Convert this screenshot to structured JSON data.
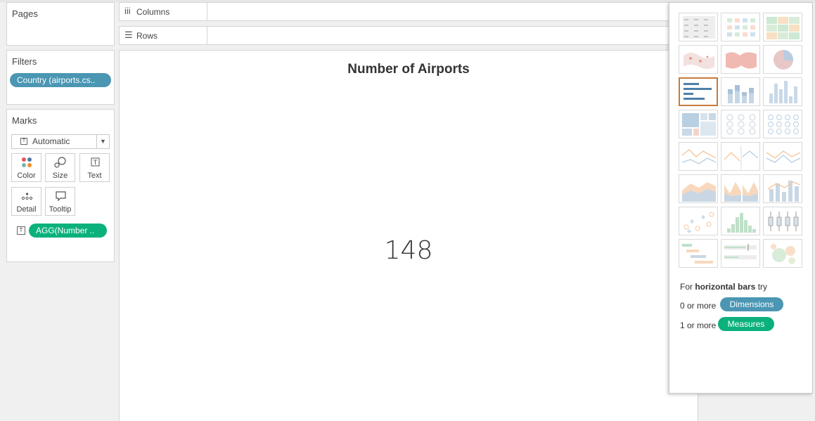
{
  "pages": {
    "title": "Pages"
  },
  "filters": {
    "title": "Filters",
    "pill": "Country (airports.cs.."
  },
  "marks": {
    "title": "Marks",
    "mark_type": "Automatic",
    "buttons": {
      "color": "Color",
      "size": "Size",
      "text": "Text",
      "detail": "Detail",
      "tooltip": "Tooltip"
    },
    "field_pill": "AGG(Number ..",
    "field_icon": "T"
  },
  "shelves": {
    "columns": "Columns",
    "rows": "Rows"
  },
  "view": {
    "title": "Number of Airports",
    "value": "148"
  },
  "show_me": {
    "hint_prefix": "For ",
    "hint_bold": "horizontal bars",
    "hint_suffix": " try",
    "dim_prefix": "0 or more",
    "dim_pill": "Dimensions",
    "meas_prefix": "1 or more",
    "meas_pill": "Measures",
    "thumbnails": [
      "text-table-icon",
      "heat-map-icon",
      "highlight-table-icon",
      "symbol-map-icon",
      "filled-map-icon",
      "pie-chart-icon",
      "horizontal-bars-icon",
      "stacked-bars-icon",
      "side-by-side-bars-icon",
      "treemap-icon",
      "circle-views-icon",
      "side-by-side-circles-icon",
      "continuous-lines-icon",
      "discrete-lines-icon",
      "dual-lines-icon",
      "area-continuous-icon",
      "area-discrete-icon",
      "dual-combination-icon",
      "scatter-plot-icon",
      "histogram-icon",
      "box-whisker-icon",
      "gantt-chart-icon",
      "bullet-graph-icon",
      "packed-bubbles-icon"
    ],
    "selected_index": 6
  },
  "colors": {
    "dimension_pill": "#4a96b3",
    "measure_pill": "#0bb17c",
    "selected_border": "#c77a3a"
  }
}
